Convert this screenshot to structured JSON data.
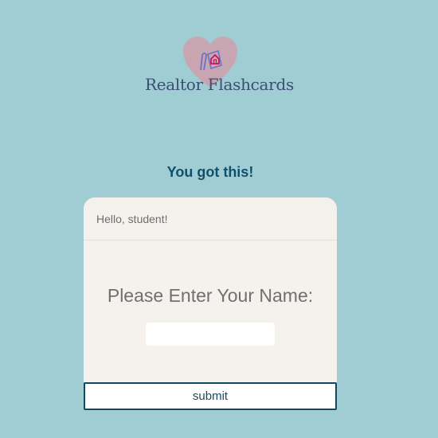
{
  "logo": {
    "text": "Realtor Flashcards",
    "icon": "heart-house-logo-icon"
  },
  "tagline": "You got this!",
  "card": {
    "greeting": "Hello, student!",
    "prompt": "Please Enter Your Name:",
    "name_input": {
      "value": "",
      "placeholder": ""
    }
  },
  "submit_label": "submit",
  "colors": {
    "background": "#a0ccd3",
    "tagline": "#11506a",
    "card": "#f5f2ee",
    "button_border": "#0e4a61",
    "heart": "#e28c9b"
  }
}
